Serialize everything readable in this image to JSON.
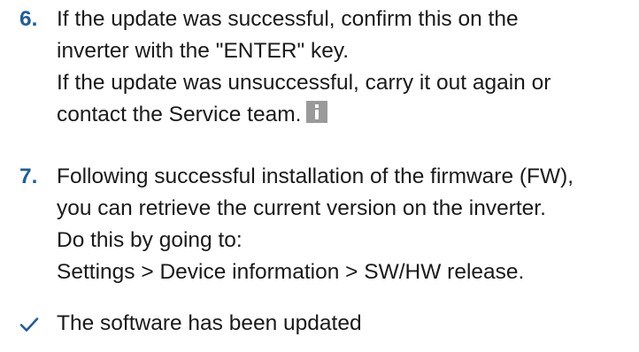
{
  "steps": [
    {
      "number": "6.",
      "lines": [
        "If the update was successful, confirm this on the",
        "inverter with the \"ENTER\" key.",
        "If the update was unsuccessful, carry it out again or",
        "contact the Service team."
      ],
      "icon": "info-icon"
    },
    {
      "number": "7.",
      "lines": [
        "Following successful installation of the firmware (FW),",
        "you can retrieve the current version on the inverter.",
        "Do this by going to:",
        "Settings > Device information > SW/HW release."
      ]
    }
  ],
  "result": {
    "icon": "checkmark-icon",
    "text": "The software has been updated"
  },
  "colors": {
    "step_number": "#1f5d99",
    "text": "#1a1a1a",
    "info_icon": "#9a9a9a",
    "check_icon": "#1f5d99"
  }
}
